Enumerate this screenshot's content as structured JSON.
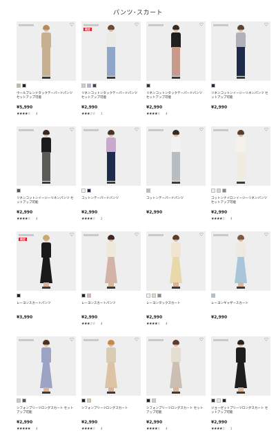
{
  "page_title": "パンツ･スカート",
  "products": [
    {
      "name": "ウールブレンドタックテーパードパンツ セットアップ可能",
      "price": "¥5,990",
      "badge": "",
      "meta": "",
      "stars": "★★★★☆",
      "reviews": "4",
      "swatches": [
        "#c9b89f",
        "#222222"
      ],
      "fig": {
        "hair": "#b78a5b",
        "top": "#c7b08f",
        "bottom": "#c7b08f",
        "type": "pants"
      }
    },
    {
      "name": "リネンコットンタックテーパードパンツ セットアップ可能",
      "price": "¥2,990",
      "badge": "限定",
      "meta": "",
      "stars": "★★★☆☆",
      "reviews": "1",
      "swatches": [
        "#cccccc",
        "#aab7cf",
        "#444444"
      ],
      "fig": {
        "hair": "#6b4a33",
        "top": "#eceae6",
        "bottom": "#8fa6c9",
        "type": "pants"
      }
    },
    {
      "name": "リネンコットンタックテーパードパンツ セットアップ可能",
      "price": "¥2,990",
      "badge": "",
      "meta": "",
      "stars": "★★★★☆",
      "reviews": "4",
      "swatches": [
        "#333333"
      ],
      "fig": {
        "hair": "#3a2a20",
        "top": "#1f1f1f",
        "bottom": "#c89a8e",
        "type": "pants"
      }
    },
    {
      "name": "リネンコットンイージーリネンパンツ セットアップ可能",
      "price": "¥2,990",
      "badge": "",
      "meta": "",
      "stars": "",
      "reviews": "",
      "swatches": [
        "#1e2a4a"
      ],
      "fig": {
        "hair": "#5c4230",
        "top": "#b0b0b8",
        "bottom": "#1e2a4a",
        "type": "pants"
      }
    },
    {
      "name": "リネンコットンイージーリネンパンツ セットアップ可能",
      "price": "¥2,990",
      "badge": "",
      "meta": "",
      "stars": "★★★★☆",
      "reviews": "4",
      "swatches": [
        "#555555"
      ],
      "fig": {
        "hair": "#3a2a20",
        "top": "#1c1c1c",
        "bottom": "#5b5b57",
        "type": "pants"
      }
    },
    {
      "name": "コットンテーパードパンツ",
      "price": "¥2,990",
      "badge": "",
      "meta": "",
      "stars": "★★★★☆",
      "reviews": "2",
      "swatches": [
        "#f2f2f2",
        "#1e2a4a"
      ],
      "fig": {
        "hair": "#4a3325",
        "top": "#c8a9cc",
        "bottom": "#1f2b4d",
        "type": "pants"
      }
    },
    {
      "name": "コットンテーパードパンツ",
      "price": "¥2,990",
      "badge": "",
      "meta": "",
      "stars": "",
      "reviews": "",
      "swatches": [
        "#bbbbbb"
      ],
      "fig": {
        "hair": "#3a2a20",
        "top": "#f2f2f2",
        "bottom": "#b8bcc4",
        "type": "pants"
      }
    },
    {
      "name": "コットンナイロンイージーリネンパンツ セットアップ可能",
      "price": "¥2,990",
      "badge": "",
      "meta": "",
      "stars": "★★★★☆",
      "reviews": "4",
      "swatches": [
        "#eeeeee",
        "#ccd6e6",
        "#888888"
      ],
      "fig": {
        "hair": "#5a3f2e",
        "top": "#f4f2ea",
        "bottom": "#f0ece1",
        "type": "pants"
      }
    },
    {
      "name": "レーヨンスカートパンツ",
      "price": "¥3,990",
      "badge": "限定",
      "meta": "",
      "stars": "",
      "reviews": "",
      "swatches": [
        "#222222"
      ],
      "fig": {
        "hair": "#c7a872",
        "top": "#1a1a1a",
        "bottom": "#1a1a1a",
        "type": "skirt"
      }
    },
    {
      "name": "レーヨンスカートパンツ",
      "price": "¥2,990",
      "badge": "",
      "meta": "",
      "stars": "★★★☆☆",
      "reviews": "4",
      "swatches": [
        "#222222",
        "#d4b7ae"
      ],
      "fig": {
        "hair": "#3a2a20",
        "top": "#efe9dc",
        "bottom": "#d2b3a8",
        "type": "skirt"
      }
    },
    {
      "name": "レーヨンタックスカート",
      "price": "¥2,990",
      "badge": "",
      "meta": "",
      "stars": "★★★★☆",
      "reviews": "4",
      "swatches": [
        "#eeeeee",
        "#e5d9b8",
        "#888888"
      ],
      "fig": {
        "hair": "#5b3e2b",
        "top": "#efe5d3",
        "bottom": "#ead8ad",
        "type": "skirt"
      }
    },
    {
      "name": "レーヨンギャザースカート",
      "price": "¥2,990",
      "badge": "",
      "meta": "",
      "stars": "",
      "reviews": "",
      "swatches": [
        "#aac3d6"
      ],
      "fig": {
        "hair": "#7a5a44",
        "top": "#eeeae2",
        "bottom": "#a9c5d9",
        "type": "skirt"
      }
    },
    {
      "name": "シフォンプリーツロングスカート セットアップ可能",
      "price": "¥2,990",
      "badge": "",
      "meta": "",
      "stars": "★★★★★",
      "reviews": "4",
      "swatches": [
        "#c9c9c9",
        "#555555"
      ],
      "fig": {
        "hair": "#4a3325",
        "top": "#9ca3c4",
        "bottom": "#9ca3c4",
        "type": "skirt"
      }
    },
    {
      "name": "シフォンプリーツロングスカート",
      "price": "¥2,990",
      "badge": "",
      "meta": "",
      "stars": "★★★★☆",
      "reviews": "4",
      "swatches": [
        "#222222",
        "#d8c7ae"
      ],
      "fig": {
        "hair": "#c58a4a",
        "top": "#d9ccb5",
        "bottom": "#dcc3a3",
        "type": "skirt"
      }
    },
    {
      "name": "シフォンプリーツロングスカート セットアップ可能",
      "price": "¥2,990",
      "badge": "",
      "meta": "",
      "stars": "★★★★☆",
      "reviews": "4",
      "swatches": [
        "#222222",
        "#cccccc"
      ],
      "fig": {
        "hair": "#5b3e2b",
        "top": "#e4ddd0",
        "bottom": "#cbbfb1",
        "type": "skirt"
      }
    },
    {
      "name": "ジョーゼットプリーツロングスカート セットアップ可能",
      "price": "¥2,990",
      "badge": "",
      "meta": "",
      "stars": "★★★★☆",
      "reviews": "1",
      "swatches": [
        "#333333",
        "#efe9dc",
        "#222222"
      ],
      "fig": {
        "hair": "#2f2219",
        "top": "#1e1e1e",
        "bottom": "#1e1e1e",
        "type": "skirt"
      }
    }
  ]
}
